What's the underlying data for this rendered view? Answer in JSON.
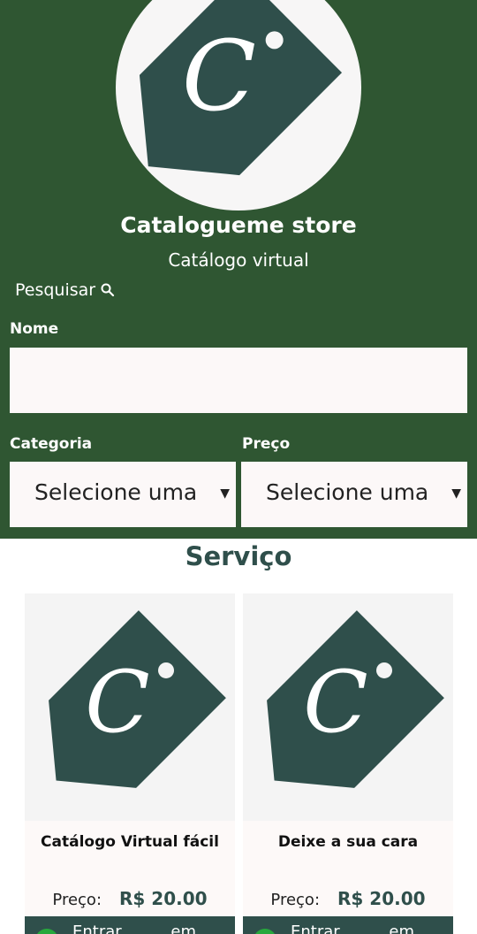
{
  "colors": {
    "header_bg": "#2f5632",
    "brand_dark": "#2f4f4b",
    "whatsapp_green": "#27a83d"
  },
  "store": {
    "logo_icon": "price-tag-c-icon",
    "name": "Catalogueme store",
    "subtitle": "Catálogo virtual"
  },
  "search": {
    "toggle_label": "Pesquisar",
    "toggle_icon": "magnifier-icon",
    "name_label": "Nome",
    "name_value": "",
    "category_label": "Categoria",
    "category_selected": "Selecione uma",
    "price_label": "Preço",
    "price_selected": "Selecione uma"
  },
  "section": {
    "title": "Serviço"
  },
  "products": [
    {
      "name": "Catálogo Virtual fácil",
      "price_label": "Preço:",
      "price": "R$ 20.00",
      "button_label_1": "Entrar",
      "button_label_2": "em"
    },
    {
      "name": "Deixe a sua cara",
      "price_label": "Preço:",
      "price": "R$ 20.00",
      "button_label_1": "Entrar",
      "button_label_2": "em"
    }
  ]
}
